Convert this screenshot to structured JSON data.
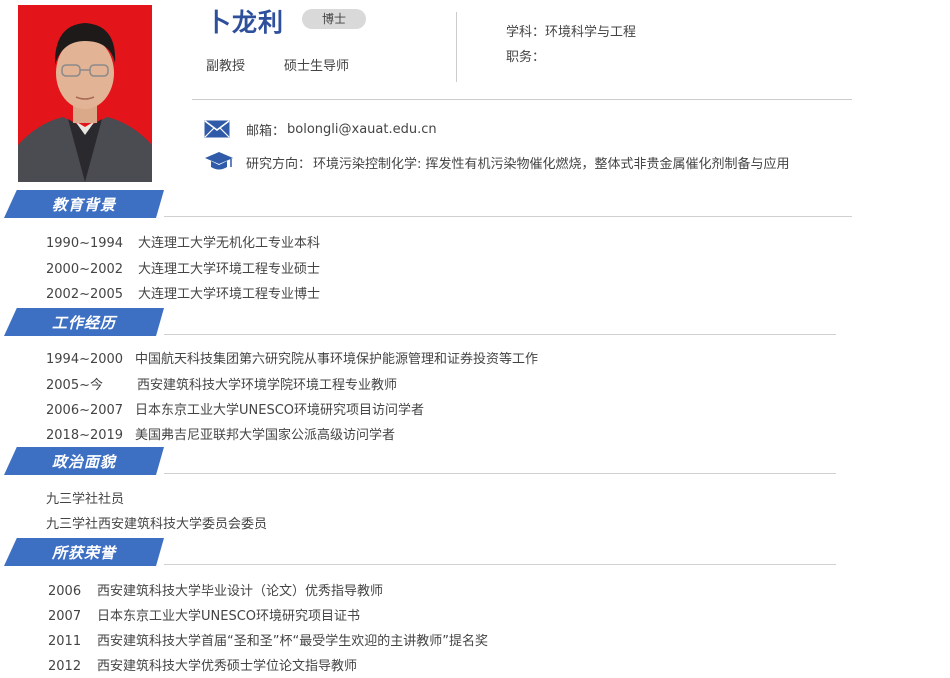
{
  "profile": {
    "name": "卜龙利",
    "degree": "博士",
    "title": "副教授",
    "role": "硕士生导师",
    "subject_label": "学科：",
    "subject": "环境科学与工程",
    "position_label": "职务：",
    "position": "",
    "email_label": "邮箱：",
    "email": "bolongli@xauat.edu.cn",
    "research_label": "研究方向：",
    "research": "环境污染控制化学: 挥发性有机污染物催化燃烧，整体式非贵金属催化剂制备与应用",
    "photo_icon": "portrait-photo"
  },
  "sections": {
    "education": {
      "title": "教育背景",
      "items": [
        {
          "year": "1990~1994",
          "text": "大连理工大学无机化工专业本科"
        },
        {
          "year": "2000~2002",
          "text": "大连理工大学环境工程专业硕士"
        },
        {
          "year": "2002~2005",
          "text": "大连理工大学环境工程专业博士"
        }
      ]
    },
    "work": {
      "title": "工作经历",
      "items": [
        {
          "year": "1994~2000",
          "text": "中国航天科技集团第六研究院从事环境保护能源管理和证券投资等工作"
        },
        {
          "year": "2005~今",
          "text": "西安建筑科技大学环境学院环境工程专业教师"
        },
        {
          "year": "2006~2007",
          "text": "日本东京工业大学UNESCO环境研究项目访问学者"
        },
        {
          "year": "2018~2019",
          "text": "美国弗吉尼亚联邦大学国家公派高级访问学者"
        }
      ]
    },
    "politics": {
      "title": "政治面貌",
      "items": [
        {
          "text": "九三学社社员"
        },
        {
          "text": "九三学社西安建筑科技大学委员会委员"
        }
      ]
    },
    "honors": {
      "title": "所获荣誉",
      "items": [
        {
          "year": "2006",
          "text": "西安建筑科技大学毕业设计（论文）优秀指导教师"
        },
        {
          "year": "2007",
          "text": "日本东京工业大学UNESCO环境研究项目证书"
        },
        {
          "year": "2011",
          "text": "西安建筑科技大学首届“圣和圣”杯“最受学生欢迎的主讲教师”提名奖"
        },
        {
          "year": "2012",
          "text": "西安建筑科技大学优秀硕士学位论文指导教师"
        }
      ]
    }
  },
  "colors": {
    "accent": "#3d6fc2",
    "name": "#2d4f9c",
    "photo_bg": "#e4141b"
  }
}
